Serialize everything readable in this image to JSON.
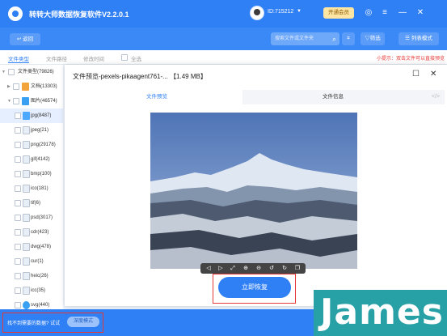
{
  "app": {
    "title": "转转大师数据恢复软件V2.2.0.1",
    "user_id": "ID:715212",
    "vip_label": "开通会员"
  },
  "toolbar": {
    "back_label": "返回",
    "search_placeholder": "搜索文件或文件夹",
    "filter_label": "筛选",
    "view_mode_label": "列表模式"
  },
  "filter_tabs": [
    "文件类型",
    "文件路径",
    "修改时间",
    "全选"
  ],
  "hint": "小提示：双击文件可以直接预览",
  "tree": [
    {
      "label": "文件类型(79826)"
    },
    {
      "label": "文档(13303)"
    },
    {
      "label": "图片(46574)"
    },
    {
      "label": "jpg(8487)"
    },
    {
      "label": "jpeg(21)"
    },
    {
      "label": "png(29178)"
    },
    {
      "label": "gif(4142)"
    },
    {
      "label": "bmp(100)"
    },
    {
      "label": "ico(181)"
    },
    {
      "label": "tif(6)"
    },
    {
      "label": "psd(3017)"
    },
    {
      "label": "cdr(423)"
    },
    {
      "label": "dwg(478)"
    },
    {
      "label": "cur(1)"
    },
    {
      "label": "heic(26)"
    },
    {
      "label": "icc(35)"
    },
    {
      "label": "svg(440)"
    }
  ],
  "preview": {
    "title": "文件预览-pexels-pikaagent761-...",
    "size": "【1.49 MB】",
    "tab_preview": "文件预览",
    "tab_info": "文件信息",
    "code_icon": "</>"
  },
  "recover_label": "立即恢复",
  "bottom": {
    "text": "找不到需要的数据? 试试",
    "button": "深度模式"
  },
  "watermark": "James",
  "colors": {
    "primary": "#2f7ff5",
    "highlight": "#e53935"
  }
}
